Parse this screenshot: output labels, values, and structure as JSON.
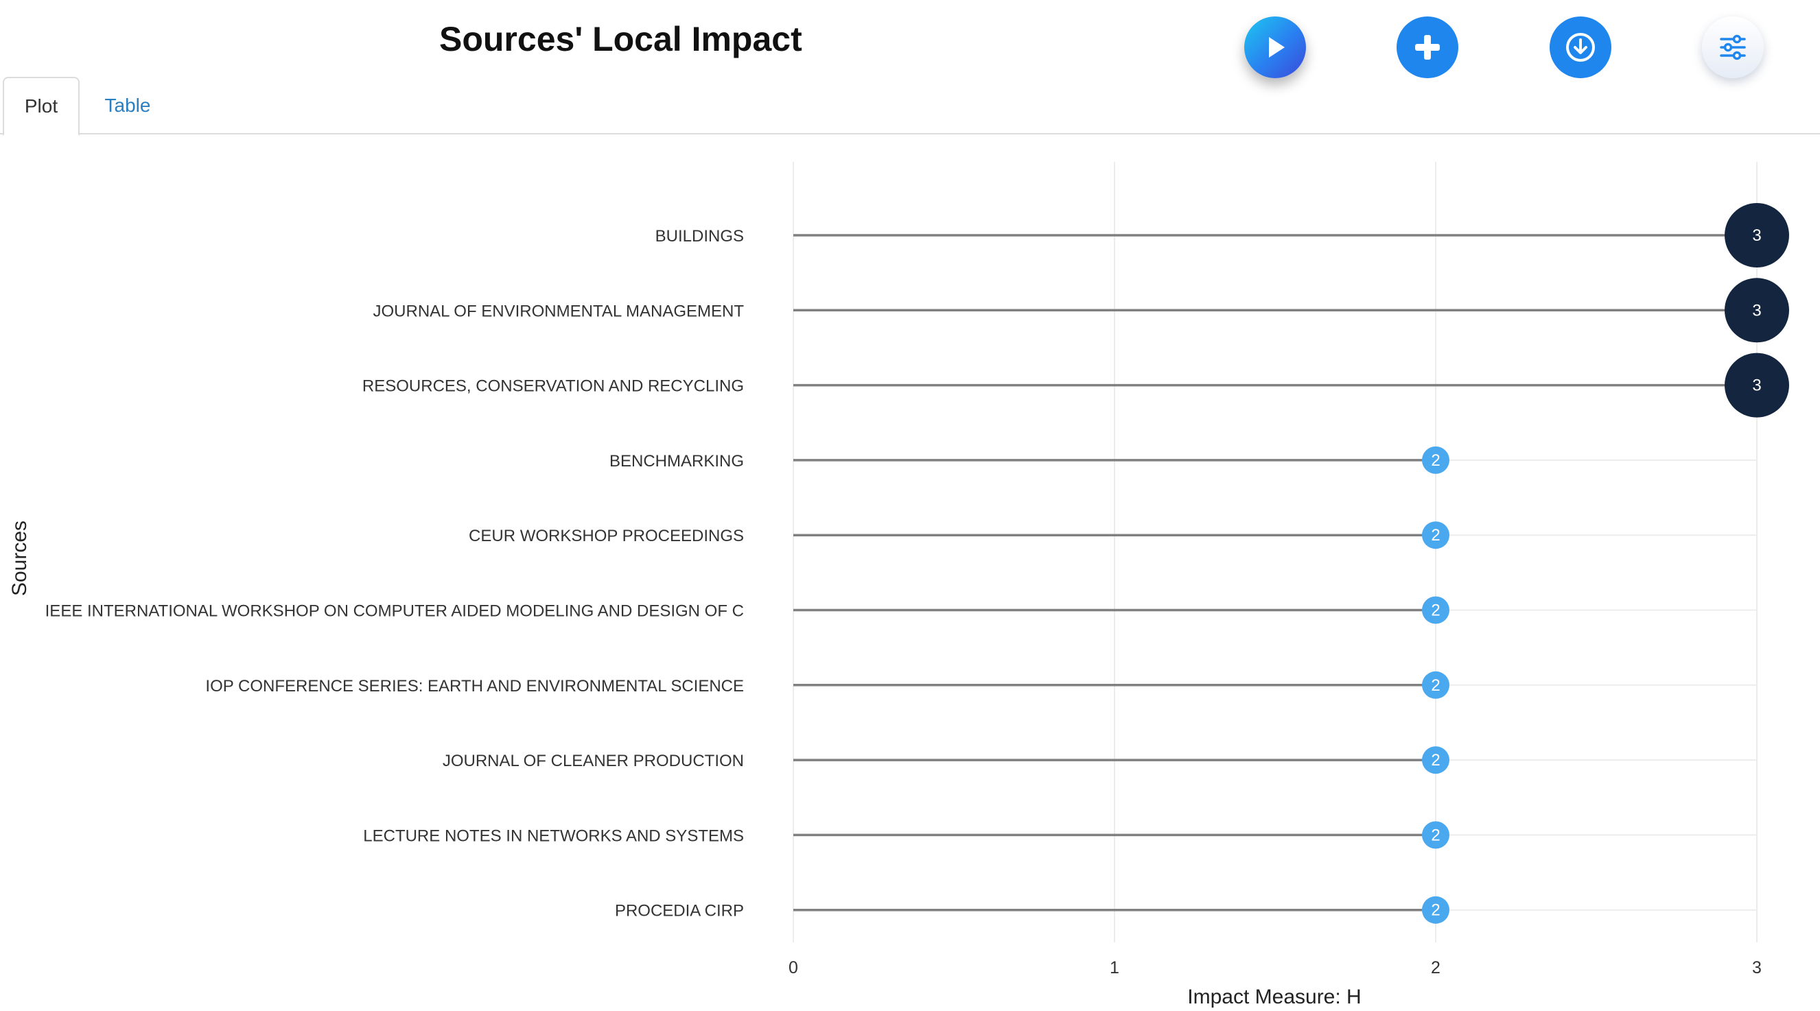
{
  "page": {
    "title": "Sources' Local Impact"
  },
  "toolbar": {
    "buttons": [
      {
        "name": "run-button",
        "icon": "play-icon"
      },
      {
        "name": "add-button",
        "icon": "plus-icon"
      },
      {
        "name": "download-button",
        "icon": "download-icon"
      },
      {
        "name": "settings-button",
        "icon": "sliders-icon"
      }
    ]
  },
  "tabs": [
    {
      "label": "Plot",
      "active": true
    },
    {
      "label": "Table",
      "active": false
    }
  ],
  "colors": {
    "accent": "#1f86ee",
    "tab_link": "#2a7fc0",
    "stem": "#808080",
    "marker_high": "#14263f",
    "marker_low": "#4aa8ef",
    "grid": "#ececec"
  },
  "chart_data": {
    "type": "lollipop",
    "xlabel": "Impact Measure: H",
    "ylabel": "Sources",
    "xlim": [
      0,
      3
    ],
    "xticks": [
      0,
      1,
      2,
      3
    ],
    "grid": true,
    "categories": [
      "BUILDINGS",
      "JOURNAL OF ENVIRONMENTAL MANAGEMENT",
      "RESOURCES, CONSERVATION AND RECYCLING",
      "BENCHMARKING",
      "CEUR WORKSHOP PROCEEDINGS",
      "IEEE INTERNATIONAL WORKSHOP ON COMPUTER AIDED MODELING AND DESIGN OF C",
      "IOP CONFERENCE SERIES: EARTH AND ENVIRONMENTAL SCIENCE",
      "JOURNAL OF CLEANER PRODUCTION",
      "LECTURE NOTES IN NETWORKS AND SYSTEMS",
      "PROCEDIA CIRP"
    ],
    "values": [
      3,
      3,
      3,
      2,
      2,
      2,
      2,
      2,
      2,
      2
    ]
  }
}
